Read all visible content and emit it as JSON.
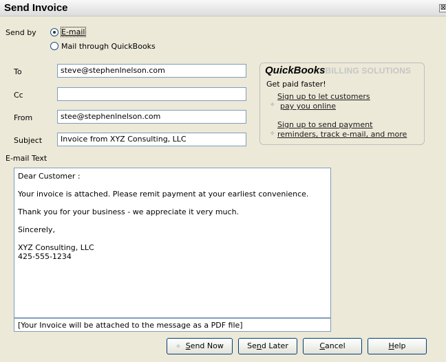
{
  "window": {
    "title": "Send Invoice",
    "close": "⊠"
  },
  "send_by": {
    "label": "Send by",
    "options": [
      "E-mail",
      "Mail through QuickBooks"
    ],
    "selected": "E-mail"
  },
  "fields": {
    "to": {
      "label": "To",
      "value": "steve@stephenlnelson.com"
    },
    "cc": {
      "label": "Cc",
      "value": ""
    },
    "from": {
      "label": "From",
      "value": "stee@stephenlnelson.com"
    },
    "subject": {
      "label": "Subject",
      "value": "Invoice from XYZ Consulting, LLC"
    }
  },
  "promo": {
    "brand": "QuickBooks",
    "suffix": "BILLING SOLUTIONS",
    "headline": "Get paid faster!",
    "link1_line1": "Sign up to let customers",
    "link1_line2": "pay you online",
    "link2_line1": "Sign up to send payment",
    "link2_line2": "reminders, track e-mail, and more"
  },
  "email_text": {
    "label": "E-mail Text",
    "greeting": "Dear Customer :",
    "para1": "Your invoice is attached.  Please remit payment at your earliest convenience.",
    "para2": "Thank you for your business - we appreciate it very much.",
    "closing": "Sincerely,",
    "sig_company": "XYZ Consulting, LLC",
    "sig_phone": "425-555-1234",
    "attachment_note": "[Your Invoice will be attached to the message as a PDF file]"
  },
  "buttons": {
    "send_now": {
      "pre": "",
      "acc": "S",
      "post": "end Now"
    },
    "send_later": {
      "pre": "Se",
      "acc": "n",
      "post": "d Later"
    },
    "cancel": {
      "pre": "",
      "acc": "C",
      "post": "ancel"
    },
    "help": {
      "pre": "",
      "acc": "H",
      "post": "elp"
    }
  },
  "icons": {
    "send_now": "sparkle-icon",
    "promo_links": "sparkle-icon"
  }
}
